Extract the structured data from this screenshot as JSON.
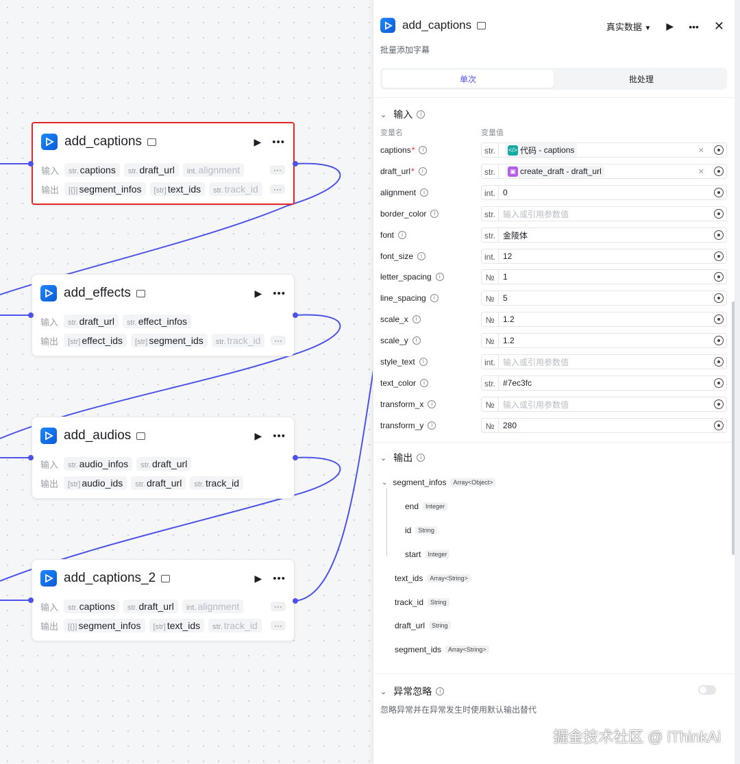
{
  "nodes": [
    {
      "title": "add_captions",
      "inputs_label": "输入",
      "outputs_label": "输出",
      "inputs": [
        {
          "type": "str.",
          "name": "captions"
        },
        {
          "type": "str.",
          "name": "draft_url"
        },
        {
          "type": "int.",
          "name": "alignment"
        }
      ],
      "outputs": [
        {
          "type": "[{}]",
          "name": "segment_infos"
        },
        {
          "type": "[str]",
          "name": "text_ids"
        },
        {
          "type": "str.",
          "name": "track_id"
        }
      ]
    },
    {
      "title": "add_effects",
      "inputs_label": "输入",
      "outputs_label": "输出",
      "inputs": [
        {
          "type": "str.",
          "name": "draft_url"
        },
        {
          "type": "str.",
          "name": "effect_infos"
        }
      ],
      "outputs": [
        {
          "type": "[str]",
          "name": "effect_ids"
        },
        {
          "type": "[str]",
          "name": "segment_ids"
        },
        {
          "type": "str.",
          "name": "track_id"
        }
      ]
    },
    {
      "title": "add_audios",
      "inputs_label": "输入",
      "outputs_label": "输出",
      "inputs": [
        {
          "type": "str.",
          "name": "audio_infos"
        },
        {
          "type": "str.",
          "name": "draft_url"
        }
      ],
      "outputs": [
        {
          "type": "[str]",
          "name": "audio_ids"
        },
        {
          "type": "str.",
          "name": "draft_url"
        },
        {
          "type": "str.",
          "name": "track_id"
        }
      ]
    },
    {
      "title": "add_captions_2",
      "inputs_label": "输入",
      "outputs_label": "输出",
      "inputs": [
        {
          "type": "str.",
          "name": "captions"
        },
        {
          "type": "str.",
          "name": "draft_url"
        },
        {
          "type": "int.",
          "name": "alignment"
        }
      ],
      "outputs": [
        {
          "type": "[{}]",
          "name": "segment_infos"
        },
        {
          "type": "[str]",
          "name": "text_ids"
        },
        {
          "type": "str.",
          "name": "track_id"
        }
      ]
    }
  ],
  "panel": {
    "title": "add_captions",
    "description": "批量添加字幕",
    "data_mode": "真实数据",
    "tabs": [
      "单次",
      "批处理"
    ],
    "input_section": "输入",
    "col_name": "变量名",
    "col_value": "变量值",
    "params": [
      {
        "name": "captions",
        "required": "*",
        "type": "str.",
        "ref_source": "代码",
        "ref_field": "captions",
        "ref_color": "#17a9a4",
        "ref_icon": "</>"
      },
      {
        "name": "draft_url",
        "required": "*",
        "type": "str.",
        "ref_source": "create_draft",
        "ref_field": "draft_url",
        "ref_color": "#b35ee6",
        "ref_icon": "▣"
      },
      {
        "name": "alignment",
        "type": "int.",
        "value": "0"
      },
      {
        "name": "border_color",
        "type": "str.",
        "placeholder": "输入或引用参数值"
      },
      {
        "name": "font",
        "type": "str.",
        "value": "金陵体"
      },
      {
        "name": "font_size",
        "type": "int.",
        "value": "12"
      },
      {
        "name": "letter_spacing",
        "type": "№",
        "value": "1"
      },
      {
        "name": "line_spacing",
        "type": "№",
        "value": "5"
      },
      {
        "name": "scale_x",
        "type": "№",
        "value": "1.2"
      },
      {
        "name": "scale_y",
        "type": "№",
        "value": "1.2"
      },
      {
        "name": "style_text",
        "type": "int.",
        "placeholder": "输入或引用参数值"
      },
      {
        "name": "text_color",
        "type": "str.",
        "value": "#7ec3fc"
      },
      {
        "name": "transform_x",
        "type": "№",
        "placeholder": "输入或引用参数值"
      },
      {
        "name": "transform_y",
        "type": "№",
        "value": "280"
      }
    ],
    "output_section": "输出",
    "outputs": [
      {
        "name": "segment_infos",
        "type": "Array<Object>"
      },
      {
        "name": "end",
        "type": "Integer"
      },
      {
        "name": "id",
        "type": "String"
      },
      {
        "name": "start",
        "type": "Integer"
      },
      {
        "name": "text_ids",
        "type": "Array<String>"
      },
      {
        "name": "track_id",
        "type": "String"
      },
      {
        "name": "draft_url",
        "type": "String"
      },
      {
        "name": "segment_ids",
        "type": "Array<String>"
      }
    ],
    "exception_section": "异常忽略",
    "exception_desc": "忽略异常并在异常发生时使用默认输出替代"
  },
  "watermark": "掘金技术社区 @ iThinkAi",
  "colors": {
    "accent": "#4d53e8",
    "selected_border": "#e3262a",
    "edge": "#4d53e8"
  }
}
